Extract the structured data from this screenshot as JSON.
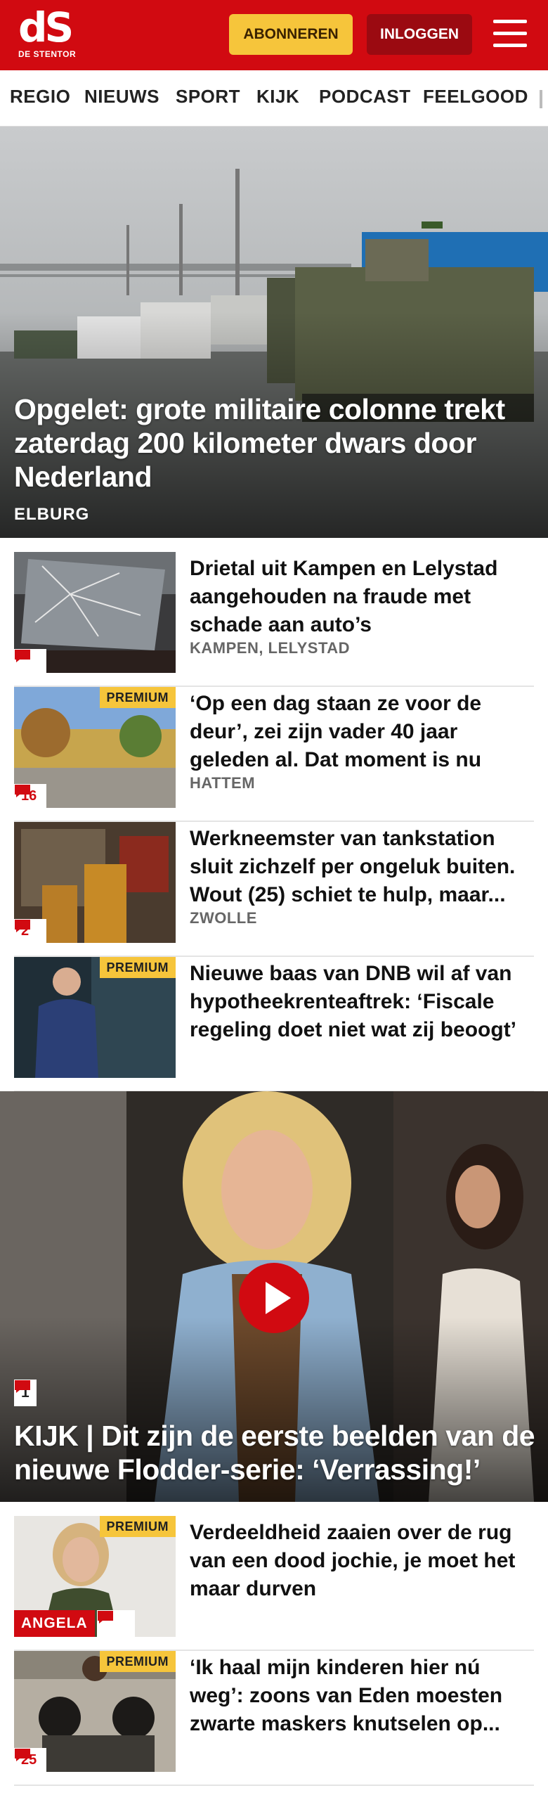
{
  "header": {
    "logo_mark": "dS",
    "logo_sub": "DE STENTOR",
    "subscribe_label": "ABONNEREN",
    "login_label": "INLOGGEN"
  },
  "nav": {
    "items": [
      "REGIO",
      "NIEUWS",
      "SPORT",
      "KIJK",
      "PODCAST",
      "FEELGOOD"
    ]
  },
  "hero": {
    "title": "Opgelet: grote militaire colonne trekt zaterdag 200 kilometer dwars door Nederland",
    "location": "ELBURG"
  },
  "articles": [
    {
      "title": "Drietal uit Kampen en Lelystad aangehouden na fraude met schade aan auto’s",
      "location": "KAMPEN, LELYSTAD",
      "comments": ""
    },
    {
      "title": "‘Op een dag staan ze voor de deur’, zei zijn vader 40 jaar geleden al. Dat moment is nu",
      "location": "HATTEM",
      "premium": "PREMIUM",
      "comments": "16"
    },
    {
      "title": "Werkneemster van tankstation sluit zichzelf per ongeluk buiten. Wout (25) schiet te hulp, maar...",
      "location": "ZWOLLE",
      "comments": "2"
    },
    {
      "title": "Nieuwe baas van DNB wil af van hypotheekrenteaftrek: ‘Fiscale regeling doet niet wat zij beoogt’",
      "premium": "PREMIUM"
    }
  ],
  "video": {
    "comments": "1",
    "title": "KIJK | Dit zijn de eerste beelden van de nieuwe Flodder-serie: ‘Verrassing!’"
  },
  "articles2": [
    {
      "title": "Verdeeldheid zaaien over de rug van een dood jochie, je moet het maar durven",
      "premium": "PREMIUM",
      "author": "ANGELA"
    },
    {
      "title": "‘Ik haal mijn kinderen hier nú weg’: zoons van Eden moesten zwarte maskers knutselen op...",
      "premium": "PREMIUM",
      "comments": "25"
    }
  ],
  "colors": {
    "brand_red": "#d10a11",
    "premium_yellow": "#f6c53b",
    "login_dark_red": "#9b0a11"
  }
}
